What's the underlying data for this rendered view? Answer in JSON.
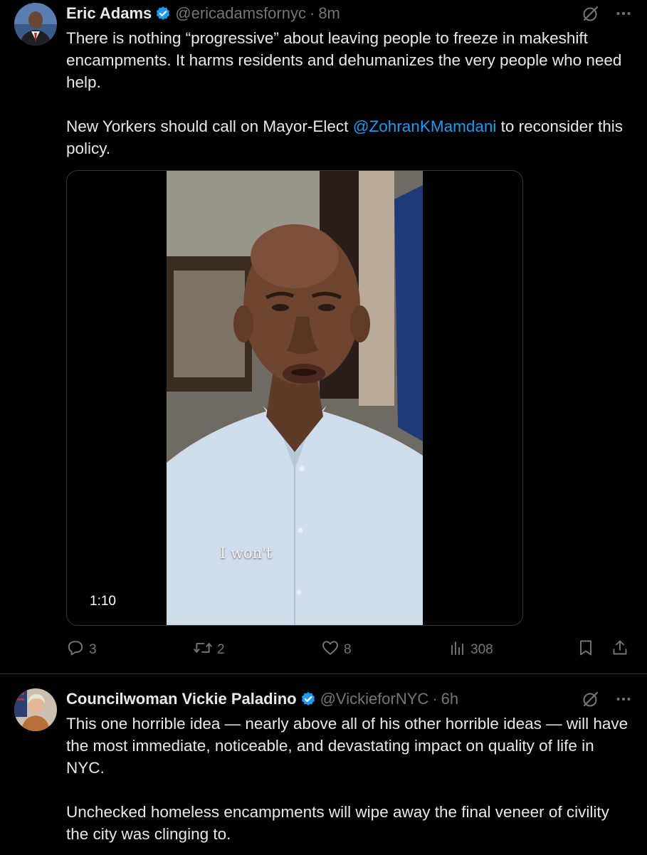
{
  "colors": {
    "background": "#000000",
    "text": "#e7e9ea",
    "secondary": "#71767b",
    "link": "#1d9bf0",
    "verified": "#1d9bf0",
    "divider": "#2f3336"
  },
  "tweets": [
    {
      "author": {
        "name": "Eric Adams",
        "handle": "@ericadamsfornyc",
        "verified": true,
        "avatar_icon": "avatar-eric-adams"
      },
      "separator": "·",
      "time": "8m",
      "text": {
        "para1": "There is nothing “progressive” about leaving people to freeze in makeshift encampments. It harms residents and dehumanizes the very people who need help.",
        "para2_prefix": "New Yorkers should call on  Mayor-Elect ",
        "para2_mention": "@ZohranKMamdani",
        "para2_suffix": "  to reconsider this policy."
      },
      "media": {
        "type": "video",
        "caption": "I won't",
        "duration": "1:10"
      },
      "actions": {
        "replies": "3",
        "reposts": "2",
        "likes": "8",
        "views": "308"
      }
    },
    {
      "author": {
        "name": "Councilwoman Vickie Paladino",
        "handle": "@VickieforNYC",
        "verified": true,
        "avatar_icon": "avatar-vickie-paladino"
      },
      "separator": "·",
      "time": "6h",
      "text": {
        "para1": "This one horrible idea — nearly above all of his other horrible ideas — will have the most immediate, noticeable, and devastating impact on quality of life in NYC.",
        "para2": "Unchecked homeless encampments will wipe away the final veneer of civility the city was clinging to."
      }
    }
  ]
}
